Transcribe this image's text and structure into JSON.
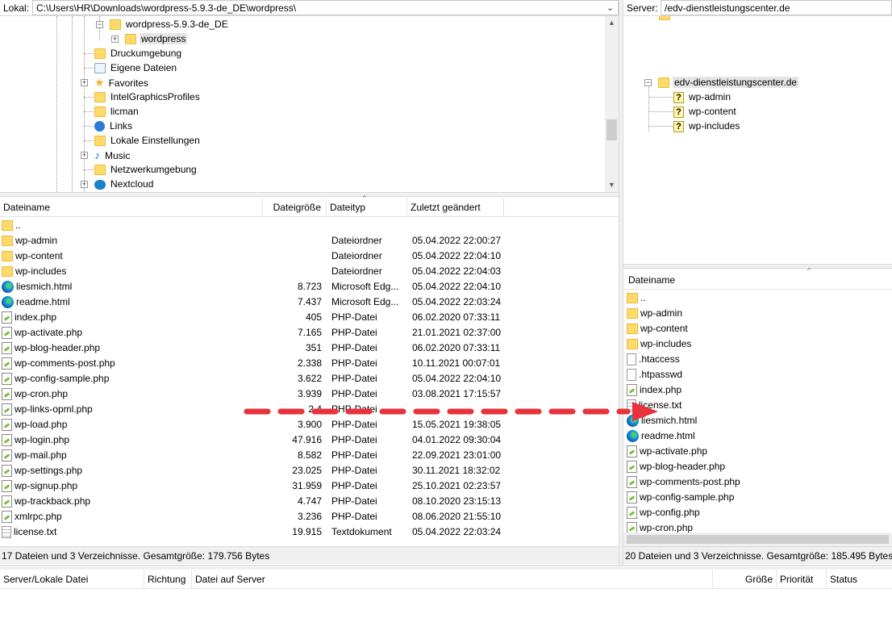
{
  "local": {
    "label": "Lokal:",
    "path": "C:\\Users\\HR\\Downloads\\wordpress-5.9.3-de_DE\\wordpress\\",
    "tree": [
      {
        "label": "wordpress-5.9.3-de_DE",
        "icon": "folder-icon"
      },
      {
        "label": "wordpress",
        "icon": "folder-icon"
      },
      {
        "label": "Druckumgebung",
        "icon": "folder-icon"
      },
      {
        "label": "Eigene Dateien",
        "icon": "document-folder-icon"
      },
      {
        "label": "Favorites",
        "icon": "star-icon"
      },
      {
        "label": "IntelGraphicsProfiles",
        "icon": "folder-icon"
      },
      {
        "label": "licman",
        "icon": "folder-icon"
      },
      {
        "label": "Links",
        "icon": "links-icon"
      },
      {
        "label": "Lokale Einstellungen",
        "icon": "folder-icon"
      },
      {
        "label": "Music",
        "icon": "music-icon"
      },
      {
        "label": "Netzwerkumgebung",
        "icon": "folder-icon"
      },
      {
        "label": "Nextcloud",
        "icon": "nextcloud-icon"
      }
    ],
    "columns": [
      "Dateiname",
      "Dateigröße",
      "Dateityp",
      "Zuletzt geändert"
    ],
    "files": [
      {
        "name": "..",
        "size": "",
        "type": "",
        "modified": "",
        "icon": "folder"
      },
      {
        "name": "wp-admin",
        "size": "",
        "type": "Dateiordner",
        "modified": "05.04.2022 22:00:27",
        "icon": "folder"
      },
      {
        "name": "wp-content",
        "size": "",
        "type": "Dateiordner",
        "modified": "05.04.2022 22:04:10",
        "icon": "folder"
      },
      {
        "name": "wp-includes",
        "size": "",
        "type": "Dateiordner",
        "modified": "05.04.2022 22:04:03",
        "icon": "folder"
      },
      {
        "name": "liesmich.html",
        "size": "8.723",
        "type": "Microsoft Edg...",
        "modified": "05.04.2022 22:04:10",
        "icon": "edge"
      },
      {
        "name": "readme.html",
        "size": "7.437",
        "type": "Microsoft Edg...",
        "modified": "05.04.2022 22:03:24",
        "icon": "edge"
      },
      {
        "name": "index.php",
        "size": "405",
        "type": "PHP-Datei",
        "modified": "06.02.2020 07:33:11",
        "icon": "php"
      },
      {
        "name": "wp-activate.php",
        "size": "7.165",
        "type": "PHP-Datei",
        "modified": "21.01.2021 02:37:00",
        "icon": "php"
      },
      {
        "name": "wp-blog-header.php",
        "size": "351",
        "type": "PHP-Datei",
        "modified": "06.02.2020 07:33:11",
        "icon": "php"
      },
      {
        "name": "wp-comments-post.php",
        "size": "2.338",
        "type": "PHP-Datei",
        "modified": "10.11.2021 00:07:01",
        "icon": "php"
      },
      {
        "name": "wp-config-sample.php",
        "size": "3.622",
        "type": "PHP-Datei",
        "modified": "05.04.2022 22:04:10",
        "icon": "php"
      },
      {
        "name": "wp-cron.php",
        "size": "3.939",
        "type": "PHP-Datei",
        "modified": "03.08.2021 17:15:57",
        "icon": "php"
      },
      {
        "name": "wp-links-opml.php",
        "size": "2.4",
        "type": "PHP-Datei",
        "modified": "",
        "icon": "php"
      },
      {
        "name": "wp-load.php",
        "size": "3.900",
        "type": "PHP-Datei",
        "modified": "15.05.2021 19:38:05",
        "icon": "php"
      },
      {
        "name": "wp-login.php",
        "size": "47.916",
        "type": "PHP-Datei",
        "modified": "04.01.2022 09:30:04",
        "icon": "php"
      },
      {
        "name": "wp-mail.php",
        "size": "8.582",
        "type": "PHP-Datei",
        "modified": "22.09.2021 23:01:00",
        "icon": "php"
      },
      {
        "name": "wp-settings.php",
        "size": "23.025",
        "type": "PHP-Datei",
        "modified": "30.11.2021 18:32:02",
        "icon": "php"
      },
      {
        "name": "wp-signup.php",
        "size": "31.959",
        "type": "PHP-Datei",
        "modified": "25.10.2021 02:23:57",
        "icon": "php"
      },
      {
        "name": "wp-trackback.php",
        "size": "4.747",
        "type": "PHP-Datei",
        "modified": "08.10.2020 23:15:13",
        "icon": "php"
      },
      {
        "name": "xmlrpc.php",
        "size": "3.236",
        "type": "PHP-Datei",
        "modified": "08.06.2020 21:55:10",
        "icon": "php"
      },
      {
        "name": "license.txt",
        "size": "19.915",
        "type": "Textdokument",
        "modified": "05.04.2022 22:03:24",
        "icon": "txt"
      }
    ],
    "status": "17 Dateien und 3 Verzeichnisse. Gesamtgröße: 179.756 Bytes"
  },
  "remote": {
    "label": "Server:",
    "path": "/edv-dienstleistungscenter.de",
    "tree": [
      {
        "label": "edv-dienstleistungscenter.de",
        "icon": "folder-icon"
      },
      {
        "label": "wp-admin",
        "icon": "unknown-folder-icon"
      },
      {
        "label": "wp-content",
        "icon": "unknown-folder-icon"
      },
      {
        "label": "wp-includes",
        "icon": "unknown-folder-icon"
      }
    ],
    "columns": [
      "Dateiname"
    ],
    "files": [
      {
        "name": "..",
        "icon": "folder"
      },
      {
        "name": "wp-admin",
        "icon": "folder"
      },
      {
        "name": "wp-content",
        "icon": "folder"
      },
      {
        "name": "wp-includes",
        "icon": "folder"
      },
      {
        "name": ".htaccess",
        "icon": "plain"
      },
      {
        "name": ".htpasswd",
        "icon": "plain"
      },
      {
        "name": "index.php",
        "icon": "php"
      },
      {
        "name": "license.txt",
        "icon": "txt"
      },
      {
        "name": "liesmich.html",
        "icon": "edge"
      },
      {
        "name": "readme.html",
        "icon": "edge"
      },
      {
        "name": "wp-activate.php",
        "icon": "php"
      },
      {
        "name": "wp-blog-header.php",
        "icon": "php"
      },
      {
        "name": "wp-comments-post.php",
        "icon": "php"
      },
      {
        "name": "wp-config-sample.php",
        "icon": "php"
      },
      {
        "name": "wp-config.php",
        "icon": "php"
      },
      {
        "name": "wp-cron.php",
        "icon": "php"
      }
    ],
    "status": "20 Dateien und 3 Verzeichnisse. Gesamtgröße: 185.495 Bytes"
  },
  "queue": {
    "columns": [
      "Server/Lokale Datei",
      "Richtung",
      "Datei auf Server",
      "Größe",
      "Priorität",
      "Status"
    ]
  },
  "annotation": {
    "arrow_color": "#e8323c"
  }
}
